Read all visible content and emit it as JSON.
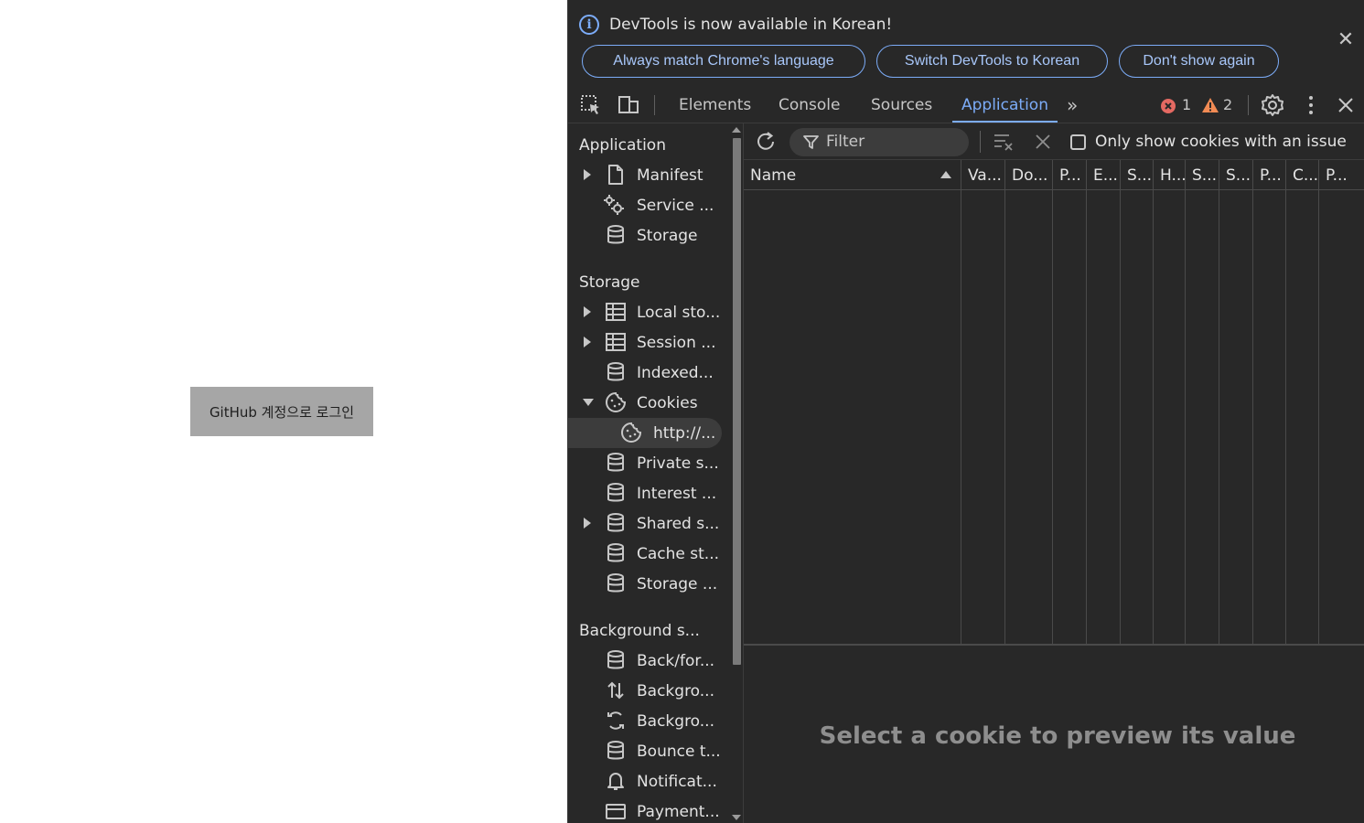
{
  "page": {
    "login_button": "GitHub 계정으로 로그인"
  },
  "infobar": {
    "message": "DevTools is now available in Korean!",
    "buttons": [
      "Always match Chrome's language",
      "Switch DevTools to Korean",
      "Don't show again"
    ]
  },
  "tabs": [
    "Elements",
    "Console",
    "Sources",
    "Application"
  ],
  "active_tab": "Application",
  "counts": {
    "errors": "1",
    "warnings": "2"
  },
  "sidebar": {
    "sections": [
      "Application",
      "Storage",
      "Background s..."
    ],
    "application_items": [
      "Manifest",
      "Service ...",
      "Storage"
    ],
    "storage_items": [
      "Local sto...",
      "Session ...",
      "Indexed...",
      "Cookies",
      "http://...",
      "Private s...",
      "Interest ...",
      "Shared s...",
      "Cache st...",
      "Storage ..."
    ],
    "background_items": [
      "Back/for...",
      "Backgro...",
      "Backgro...",
      "Bounce t...",
      "Notificat...",
      "Payment..."
    ]
  },
  "toolbar": {
    "filter_placeholder": "Filter",
    "checkbox_label": "Only show cookies with an issue"
  },
  "table": {
    "columns": [
      "Name",
      "Va...",
      "Do...",
      "P...",
      "E...",
      "S...",
      "H...",
      "S...",
      "S...",
      "P...",
      "C...",
      "P..."
    ]
  },
  "preview": {
    "message": "Select a cookie to preview its value"
  },
  "colors": {
    "accent": "#7cacf8",
    "error": "#e46962",
    "warning": "#f28b54",
    "panel_bg": "#282828"
  }
}
